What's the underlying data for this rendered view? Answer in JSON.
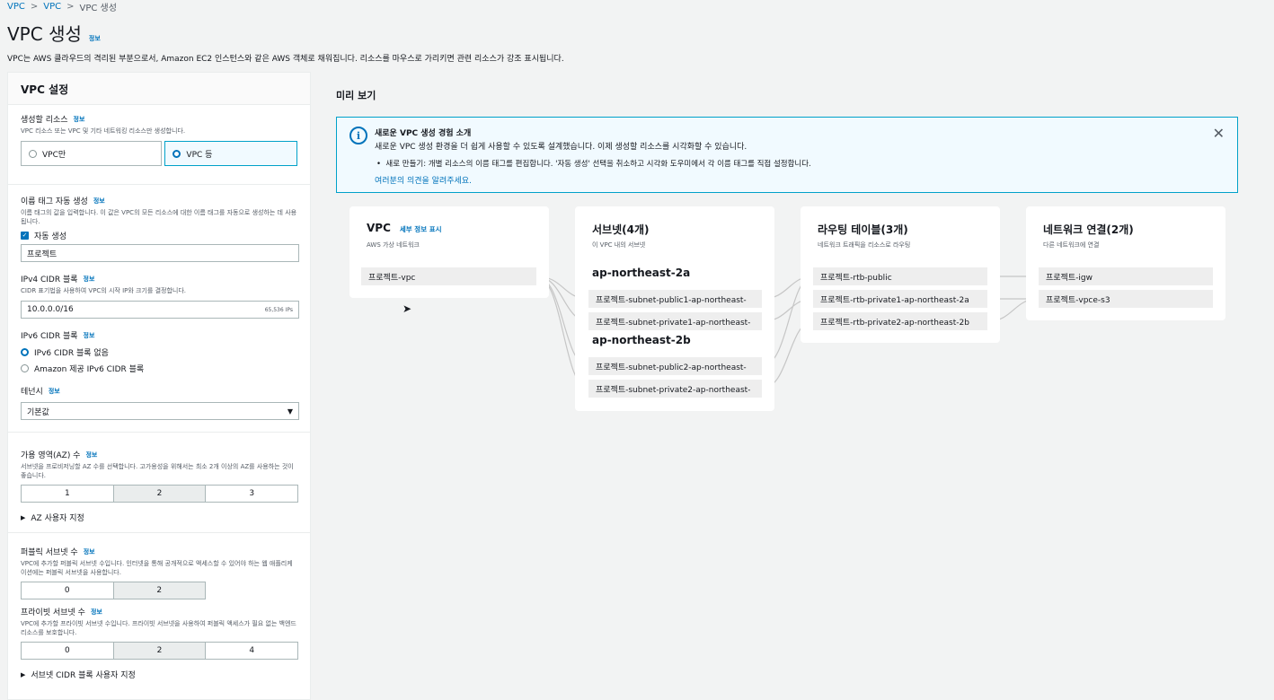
{
  "breadcrumb": [
    "VPC",
    "VPC",
    "VPC 생성"
  ],
  "page": {
    "title": "VPC 생성",
    "info": "정보",
    "description": "VPC는 AWS 클라우드의 격리된 부분으로서, Amazon EC2 인스턴스와 같은 AWS 객체로 채워집니다. 리소스를 마우스로 가리키면 관련 리소스가 강조 표시됩니다."
  },
  "settings": {
    "header": "VPC 설정",
    "resources": {
      "label": "생성할 리소스",
      "info": "정보",
      "desc": "VPC 리소스 또는 VPC 및 기타 네트워킹 리소스만 생성합니다.",
      "options": [
        "VPC만",
        "VPC 등"
      ],
      "selected": "VPC 등"
    },
    "name_tag": {
      "label": "이름 태그 자동 생성",
      "info": "정보",
      "desc": "이름 태그의 값을 입력합니다. 이 값은 VPC의 모든 리소스에 대한 이름 태그를 자동으로 생성하는 데 사용됩니다.",
      "checkbox": "자동 생성",
      "value": "프로젝트"
    },
    "ipv4": {
      "label": "IPv4 CIDR 블록",
      "info": "정보",
      "desc": "CIDR 표기법을 사용하여 VPC의 시작 IP와 크기를 결정합니다.",
      "value": "10.0.0.0/16",
      "hint": "65,536 IPs"
    },
    "ipv6": {
      "label": "IPv6 CIDR 블록",
      "info": "정보",
      "options": [
        "IPv6 CIDR 블록 없음",
        "Amazon 제공 IPv6 CIDR 블록"
      ],
      "selected": "IPv6 CIDR 블록 없음"
    },
    "tenancy": {
      "label": "테넌시",
      "info": "정보",
      "value": "기본값"
    },
    "az": {
      "label": "가용 영역(AZ) 수",
      "info": "정보",
      "desc": "서브넷을 프로비저닝할 AZ 수를 선택합니다. 고가용성을 위해서는 최소 2개 이상의 AZ를 사용하는 것이 좋습니다.",
      "options": [
        "1",
        "2",
        "3"
      ],
      "selected": "2",
      "customize": "AZ 사용자 지정"
    },
    "public_subnets": {
      "label": "퍼블릭 서브넷 수",
      "info": "정보",
      "desc": "VPC에 추가할 퍼블릭 서브넷 수입니다. 인터넷을 통해 공개적으로 액세스할 수 있어야 하는 웹 애플리케이션에는 퍼블릭 서브넷을 사용합니다.",
      "options": [
        "0",
        "2"
      ],
      "selected": "2"
    },
    "private_subnets": {
      "label": "프라이빗 서브넷 수",
      "info": "정보",
      "desc": "VPC에 추가할 프라이빗 서브넷 수입니다. 프라이빗 서브넷을 사용하여 퍼블릭 액세스가 필요 없는 백엔드 리소스를 보호합니다.",
      "options": [
        "0",
        "2",
        "4"
      ],
      "selected": "2",
      "customize": "서브넷 CIDR 블록 사용자 지정"
    }
  },
  "preview": {
    "title": "미리 보기",
    "notice": {
      "title": "새로운 VPC 생성 경험 소개",
      "line": "새로운 VPC 생성 환경을 더 쉽게 사용할 수 있도록 설계했습니다. 이제 생성할 리소스를 시각화할 수 있습니다.",
      "bullet": "새로 만들기: 개별 리소스의 이름 태그를 편집합니다. '자동 생성' 선택을 취소하고 시각화 도우미에서 각 이름 태그를 직접 설정합니다.",
      "feedback": "여러분의 의견을 알려주세요."
    },
    "vpc": {
      "title": "VPC",
      "details_link": "세부 정보 표시",
      "sub": "AWS 가상 네트워크",
      "items": [
        "프로젝트-vpc"
      ]
    },
    "subnets": {
      "title": "서브넷(4개)",
      "sub": "이 VPC 내의 서브넷",
      "zones": [
        {
          "name": "ap-northeast-2a",
          "items": [
            "프로젝트-subnet-public1-ap-northeast-",
            "프로젝트-subnet-private1-ap-northeast-"
          ]
        },
        {
          "name": "ap-northeast-2b",
          "items": [
            "프로젝트-subnet-public2-ap-northeast-",
            "프로젝트-subnet-private2-ap-northeast-"
          ]
        }
      ]
    },
    "route_tables": {
      "title": "라우팅 테이블(3개)",
      "sub": "네트워크 트래픽을 리소스로 라우팅",
      "items": [
        "프로젝트-rtb-public",
        "프로젝트-rtb-private1-ap-northeast-2a",
        "프로젝트-rtb-private2-ap-northeast-2b"
      ]
    },
    "network": {
      "title": "네트워크 연결(2개)",
      "sub": "다른 네트워크에 연결",
      "items": [
        "프로젝트-igw",
        "프로젝트-vpce-s3"
      ]
    }
  },
  "colors": {
    "link": "#0073bb",
    "selected_border": "#00a1c9",
    "info_bg": "#f1faff"
  }
}
